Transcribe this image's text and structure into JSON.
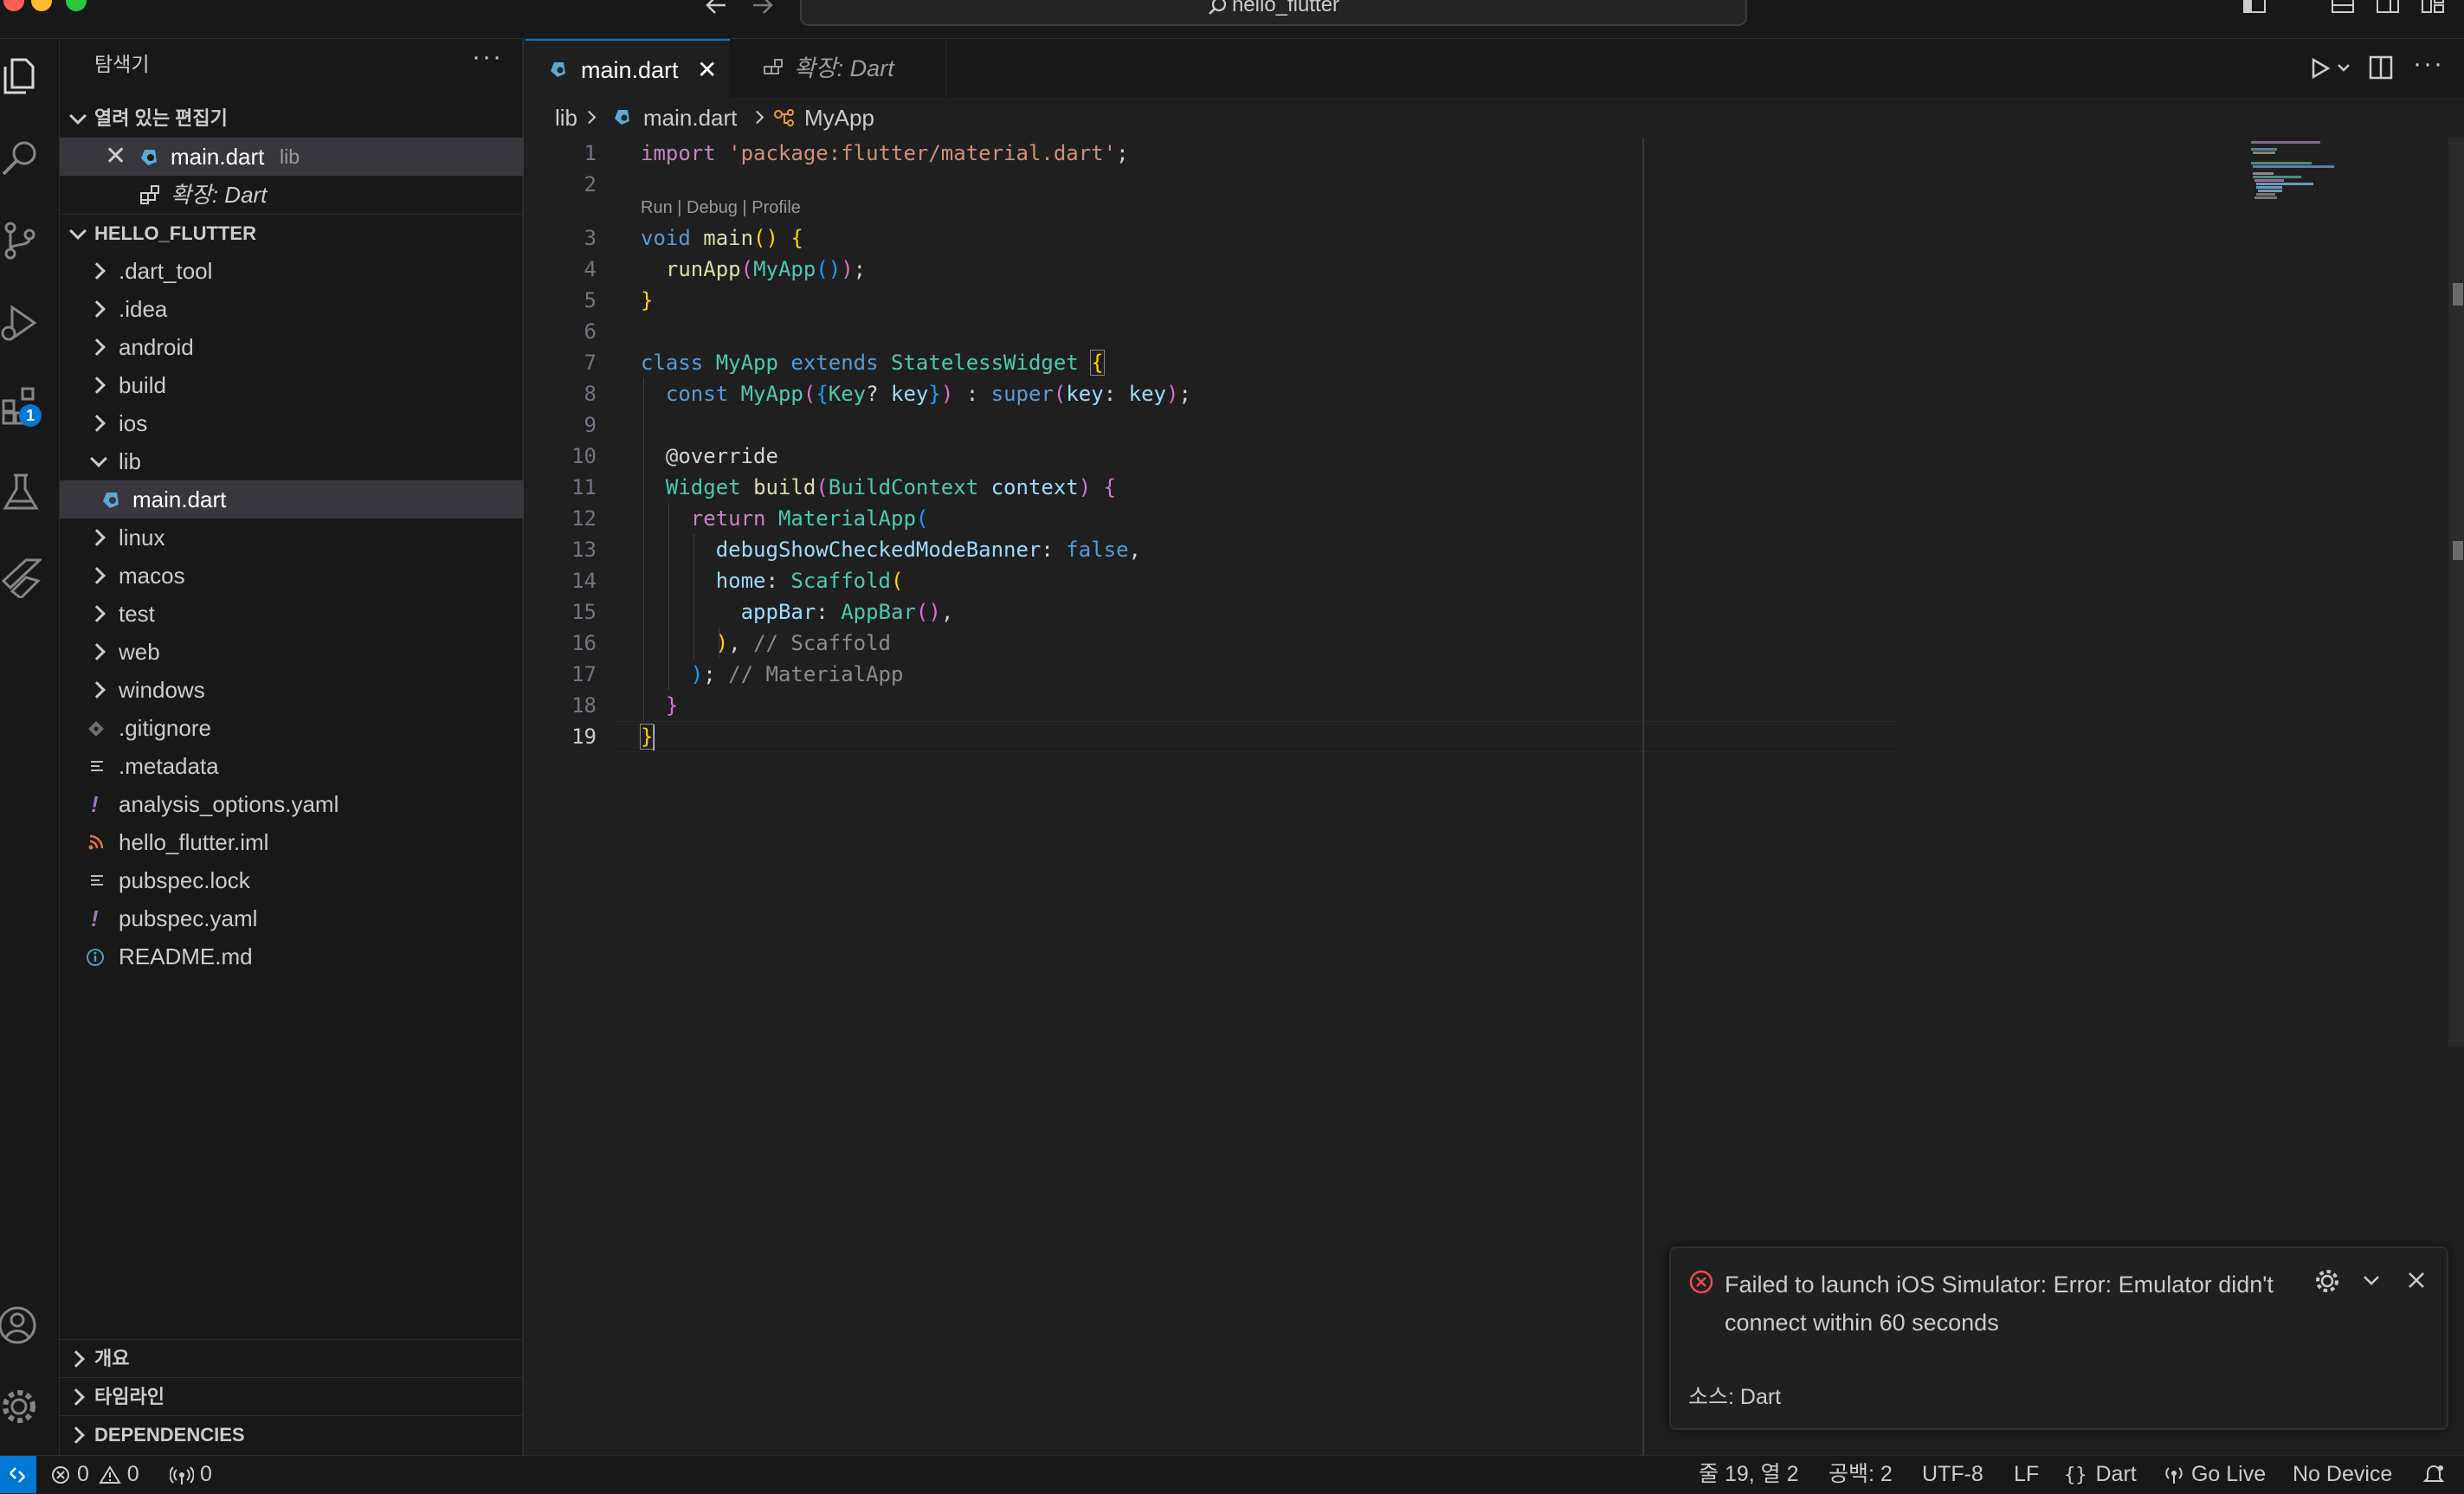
{
  "titlebar": {
    "search_text": "hello_flutter"
  },
  "activity": {
    "extensions_badge": "1"
  },
  "sidebar": {
    "title": "탐색기",
    "open_editors_header": "열려 있는 편집기",
    "open_editors": [
      {
        "name": "main.dart",
        "detail": "lib"
      },
      {
        "name": "확장: Dart"
      }
    ],
    "project_header": "HELLO_FLUTTER",
    "tree": [
      {
        "label": ".dart_tool"
      },
      {
        "label": ".idea"
      },
      {
        "label": "android"
      },
      {
        "label": "build"
      },
      {
        "label": "ios"
      },
      {
        "label": "lib"
      },
      {
        "label": "main.dart"
      },
      {
        "label": "linux"
      },
      {
        "label": "macos"
      },
      {
        "label": "test"
      },
      {
        "label": "web"
      },
      {
        "label": "windows"
      },
      {
        "label": ".gitignore"
      },
      {
        "label": ".metadata"
      },
      {
        "label": "analysis_options.yaml"
      },
      {
        "label": "hello_flutter.iml"
      },
      {
        "label": "pubspec.lock"
      },
      {
        "label": "pubspec.yaml"
      },
      {
        "label": "README.md"
      }
    ],
    "bottom_sections": [
      "개요",
      "타임라인",
      "DEPENDENCIES"
    ]
  },
  "tabs": [
    {
      "label": "main.dart",
      "active": true
    },
    {
      "label": "확장: Dart",
      "active": false
    }
  ],
  "breadcrumbs": [
    "lib",
    "main.dart",
    "MyApp"
  ],
  "editor": {
    "codelens": "Run | Debug | Profile",
    "line_numbers": [
      "1",
      "2",
      "3",
      "4",
      "5",
      "6",
      "7",
      "8",
      "9",
      "10",
      "11",
      "12",
      "13",
      "14",
      "15",
      "16",
      "17",
      "18",
      "19"
    ],
    "current_line": "19",
    "lines": {
      "l1": [
        "import",
        " ",
        "'package:flutter/material.dart'",
        ";"
      ],
      "l3": [
        "void",
        " ",
        "main",
        "()",
        " ",
        "{"
      ],
      "l4": [
        "  ",
        "runApp",
        "(",
        "MyApp",
        "()",
        ")",
        ";"
      ],
      "l5": [
        "}"
      ],
      "l7": [
        "class",
        " ",
        "MyApp",
        " ",
        "extends",
        " ",
        "StatelessWidget",
        " ",
        "{"
      ],
      "l8": [
        "  ",
        "const",
        " ",
        "MyApp",
        "(",
        "{",
        "Key",
        "?",
        " ",
        "key",
        "}",
        ")",
        " : ",
        "super",
        "(",
        "key",
        ": ",
        "key",
        ")",
        ";"
      ],
      "l10": [
        "  ",
        "@override"
      ],
      "l11": [
        "  ",
        "Widget",
        " ",
        "build",
        "(",
        "BuildContext",
        " ",
        "context",
        ")",
        " ",
        "{"
      ],
      "l12": [
        "    ",
        "return",
        " ",
        "MaterialApp",
        "("
      ],
      "l13": [
        "      ",
        "debugShowCheckedModeBanner",
        ": ",
        "false",
        ","
      ],
      "l14": [
        "      ",
        "home",
        ": ",
        "Scaffold",
        "("
      ],
      "l15": [
        "        ",
        "appBar",
        ": ",
        "AppBar",
        "()",
        ","
      ],
      "l16": [
        "      ",
        ")",
        ", ",
        "// Scaffold"
      ],
      "l17": [
        "    ",
        ")",
        "; ",
        "// MaterialApp"
      ],
      "l18": [
        "  ",
        "}"
      ],
      "l19": [
        "}"
      ]
    }
  },
  "notification": {
    "message_line1": "Failed to launch iOS Simulator: Error: Emulator didn't",
    "message_line2": "connect within 60 seconds",
    "source": "소스: Dart"
  },
  "statusbar": {
    "errors": "0",
    "warnings": "0",
    "ports": "0",
    "position": "줄 19, 열 2",
    "spaces": "공백: 2",
    "encoding": "UTF-8",
    "eol": "LF",
    "language": "Dart",
    "golive": "Go Live",
    "device": "No Device"
  },
  "colors": {
    "accent": "#0078d4",
    "background": "#1f1f1f",
    "sidebar": "#181818",
    "error": "#f14c4c"
  }
}
